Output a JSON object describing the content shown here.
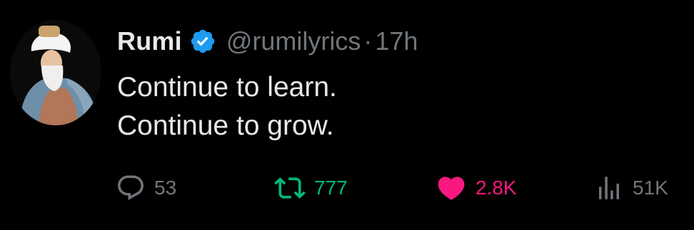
{
  "author": {
    "name": "Rumi",
    "handle": "@rumilyrics",
    "separator": "·",
    "time": "17h",
    "verified": true
  },
  "tweet": {
    "lines": [
      "Continue to learn.",
      "Continue to grow."
    ]
  },
  "actions": {
    "replies": "53",
    "retweets": "777",
    "likes": "2.8K",
    "views": "51K"
  },
  "colors": {
    "background": "#000000",
    "text": "#e7e9ea",
    "muted": "#71767b",
    "verified": "#1d9bf0",
    "retweet_active": "#00ba7c",
    "like_active": "#f91880"
  },
  "icons": {
    "reply": "reply-icon",
    "retweet": "retweet-icon",
    "like": "heart-icon",
    "views": "views-icon",
    "verified": "verified-badge-icon"
  }
}
